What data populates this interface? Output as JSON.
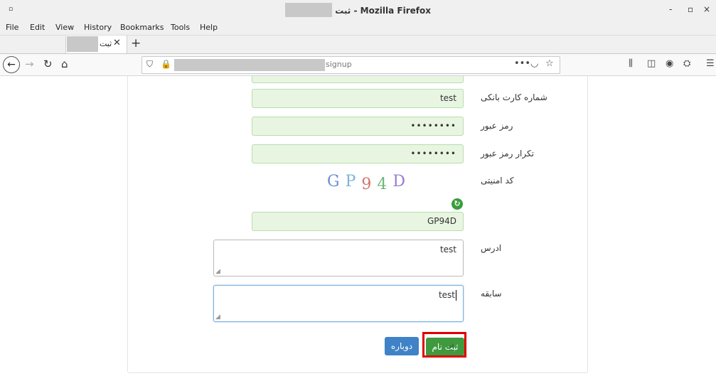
{
  "window": {
    "title_suffix": "ثبت - Mozilla Firefox",
    "app_icon": "▫",
    "controls": {
      "minimize": "-",
      "maximize": "▫",
      "close": "×"
    }
  },
  "menu": [
    "File",
    "Edit",
    "View",
    "History",
    "Bookmarks",
    "Tools",
    "Help"
  ],
  "tab": {
    "title": "ثبت",
    "close": "✕",
    "new_tab": "+"
  },
  "nav": {
    "back": "←",
    "forward": "→",
    "reload": "↻",
    "home": "⌂",
    "url_visible": "signup",
    "page_actions": "•••",
    "pocket": "◡",
    "bookmark_star": "☆",
    "library": "⫼",
    "sidebar": "◫",
    "account": "◉",
    "extension": "⛭",
    "menu": "☰"
  },
  "form": {
    "card_number": {
      "label": "شماره کارت بانکی",
      "value": "test"
    },
    "password": {
      "label": "رمز عبور",
      "value": "••••••••"
    },
    "password_repeat": {
      "label": "تکرار رمز عبور",
      "value": "••••••••"
    },
    "security_code": {
      "label": "کد امنیتی",
      "captcha_chars": [
        {
          "ch": "G",
          "color": "#6a8fd6"
        },
        {
          "ch": "P",
          "color": "#7fb2d8"
        },
        {
          "ch": "9",
          "color": "#d3756b"
        },
        {
          "ch": "4",
          "color": "#6fb47a"
        },
        {
          "ch": "D",
          "color": "#9a7bd3"
        }
      ],
      "value": "GP94D"
    },
    "address": {
      "label": "ادرس",
      "value": "test"
    },
    "history": {
      "label": "سابقه",
      "value": "test"
    },
    "retry_button": "دوباره",
    "submit_button": "ثبت نام"
  },
  "colors": {
    "field_bg": "#e8f6e1",
    "submit": "#3f9a3f",
    "retry": "#3f82c7",
    "highlight": "#e00000"
  }
}
